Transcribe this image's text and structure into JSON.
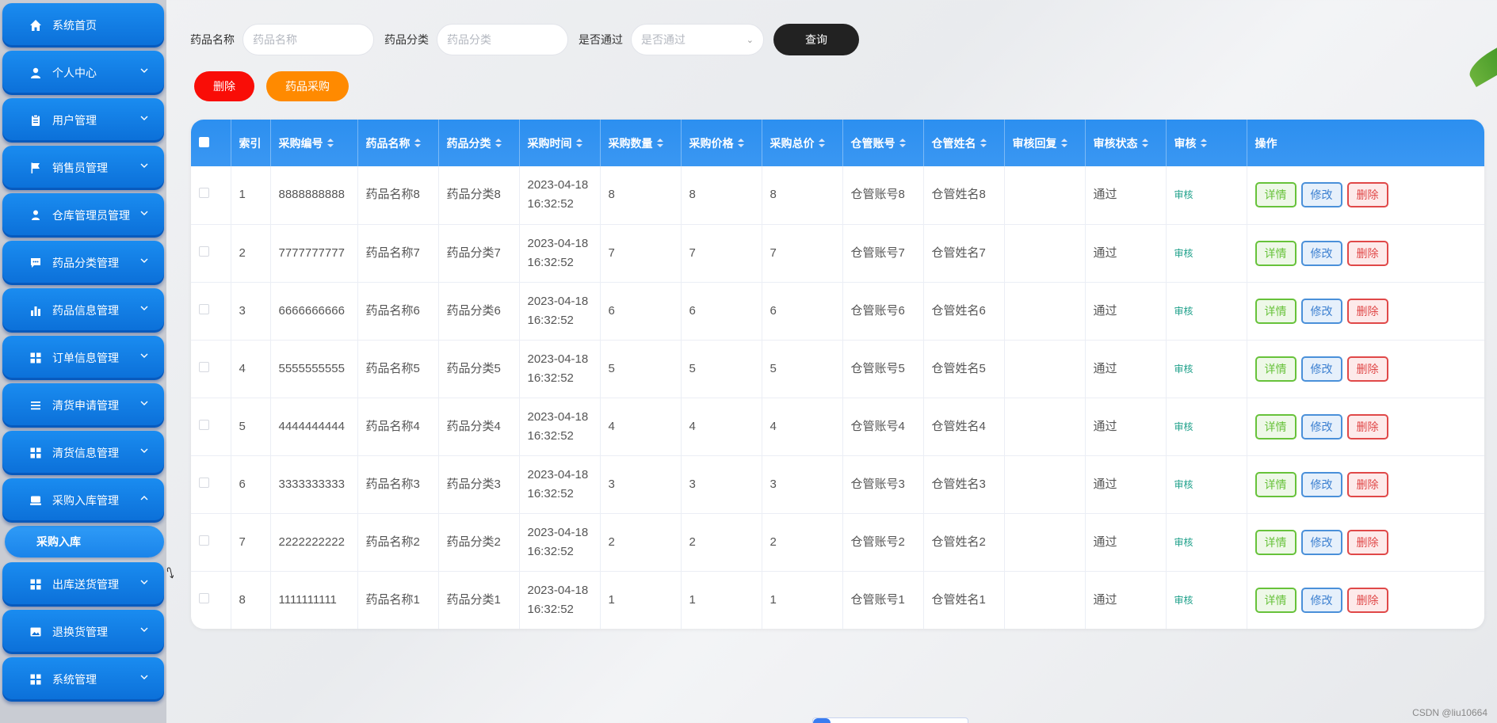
{
  "sidebar": {
    "items": [
      {
        "label": "系统首页",
        "icon": "home-icon",
        "has_chevron": false
      },
      {
        "label": "个人中心",
        "icon": "user-icon",
        "has_chevron": true
      },
      {
        "label": "用户管理",
        "icon": "clipboard-icon",
        "has_chevron": true
      },
      {
        "label": "销售员管理",
        "icon": "flag-icon",
        "has_chevron": true
      },
      {
        "label": "仓库管理员管理",
        "icon": "person-icon",
        "has_chevron": true
      },
      {
        "label": "药品分类管理",
        "icon": "chat-icon",
        "has_chevron": true
      },
      {
        "label": "药品信息管理",
        "icon": "bar-chart-icon",
        "has_chevron": true
      },
      {
        "label": "订单信息管理",
        "icon": "grid-icon",
        "has_chevron": true
      },
      {
        "label": "清货申请管理",
        "icon": "list-icon",
        "has_chevron": true
      },
      {
        "label": "清货信息管理",
        "icon": "grid-icon",
        "has_chevron": true
      },
      {
        "label": "采购入库管理",
        "icon": "cart-icon",
        "has_chevron": true,
        "expanded": true
      },
      {
        "label": "出库送货管理",
        "icon": "grid-icon",
        "has_chevron": true
      },
      {
        "label": "退换货管理",
        "icon": "image-icon",
        "has_chevron": true
      },
      {
        "label": "系统管理",
        "icon": "grid-icon",
        "has_chevron": true
      }
    ],
    "sub_item": {
      "label": "采购入库"
    }
  },
  "search": {
    "name_label": "药品名称",
    "name_placeholder": "药品名称",
    "category_label": "药品分类",
    "category_placeholder": "药品分类",
    "pass_label": "是否通过",
    "pass_placeholder": "是否通过",
    "query_button": "查询"
  },
  "actions": {
    "delete_label": "删除",
    "purchase_label": "药品采购"
  },
  "table": {
    "columns": [
      "索引",
      "采购编号",
      "药品名称",
      "药品分类",
      "采购时间",
      "采购数量",
      "采购价格",
      "采购总价",
      "仓管账号",
      "仓管姓名",
      "审核回复",
      "审核状态",
      "审核",
      "操作"
    ],
    "rows": [
      {
        "index": "1",
        "code": "8888888888",
        "name": "药品名称8",
        "category": "药品分类8",
        "date": "2023-04-18",
        "time": "16:32:52",
        "qty": "8",
        "price": "8",
        "total": "8",
        "account": "仓管账号8",
        "keeper": "仓管姓名8",
        "reply": "",
        "status": "通过",
        "audit": "审核"
      },
      {
        "index": "2",
        "code": "7777777777",
        "name": "药品名称7",
        "category": "药品分类7",
        "date": "2023-04-18",
        "time": "16:32:52",
        "qty": "7",
        "price": "7",
        "total": "7",
        "account": "仓管账号7",
        "keeper": "仓管姓名7",
        "reply": "",
        "status": "通过",
        "audit": "审核"
      },
      {
        "index": "3",
        "code": "6666666666",
        "name": "药品名称6",
        "category": "药品分类6",
        "date": "2023-04-18",
        "time": "16:32:52",
        "qty": "6",
        "price": "6",
        "total": "6",
        "account": "仓管账号6",
        "keeper": "仓管姓名6",
        "reply": "",
        "status": "通过",
        "audit": "审核"
      },
      {
        "index": "4",
        "code": "5555555555",
        "name": "药品名称5",
        "category": "药品分类5",
        "date": "2023-04-18",
        "time": "16:32:52",
        "qty": "5",
        "price": "5",
        "total": "5",
        "account": "仓管账号5",
        "keeper": "仓管姓名5",
        "reply": "",
        "status": "通过",
        "audit": "审核"
      },
      {
        "index": "5",
        "code": "4444444444",
        "name": "药品名称4",
        "category": "药品分类4",
        "date": "2023-04-18",
        "time": "16:32:52",
        "qty": "4",
        "price": "4",
        "total": "4",
        "account": "仓管账号4",
        "keeper": "仓管姓名4",
        "reply": "",
        "status": "通过",
        "audit": "审核"
      },
      {
        "index": "6",
        "code": "3333333333",
        "name": "药品名称3",
        "category": "药品分类3",
        "date": "2023-04-18",
        "time": "16:32:52",
        "qty": "3",
        "price": "3",
        "total": "3",
        "account": "仓管账号3",
        "keeper": "仓管姓名3",
        "reply": "",
        "status": "通过",
        "audit": "审核"
      },
      {
        "index": "7",
        "code": "2222222222",
        "name": "药品名称2",
        "category": "药品分类2",
        "date": "2023-04-18",
        "time": "16:32:52",
        "qty": "2",
        "price": "2",
        "total": "2",
        "account": "仓管账号2",
        "keeper": "仓管姓名2",
        "reply": "",
        "status": "通过",
        "audit": "审核"
      },
      {
        "index": "8",
        "code": "1111111111",
        "name": "药品名称1",
        "category": "药品分类1",
        "date": "2023-04-18",
        "time": "16:32:52",
        "qty": "1",
        "price": "1",
        "total": "1",
        "account": "仓管账号1",
        "keeper": "仓管姓名1",
        "reply": "",
        "status": "通过",
        "audit": "审核"
      }
    ],
    "row_actions": {
      "detail": "详情",
      "edit": "修改",
      "delete": "删除"
    }
  },
  "watermark": "CSDN @liu10664",
  "colors": {
    "sidebar_blue": "#0b6fd8",
    "header_blue": "#2c8ff0",
    "query_black": "#222222",
    "delete_red": "#f90d07",
    "purchase_orange": "#ff8a00",
    "audit_green": "#1ea08a"
  }
}
